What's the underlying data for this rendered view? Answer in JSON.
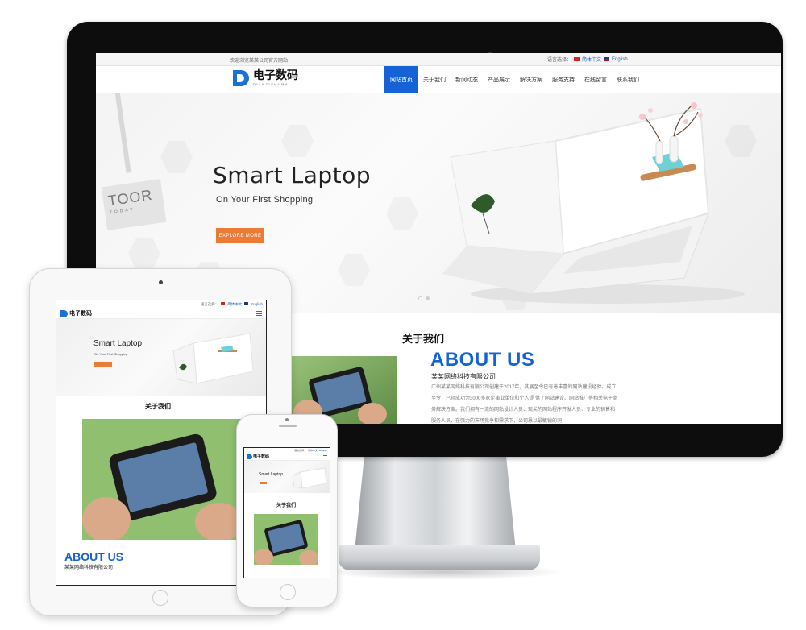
{
  "desktop": {
    "topbar": {
      "welcome": "欢迎浏览某某公司官方网站",
      "lang_label": "语言选择：",
      "lang_cn": "简体中文",
      "lang_en": "English"
    },
    "logo": {
      "cn": "电子数码",
      "en": "DIANZISHUMA"
    },
    "nav": [
      {
        "label": "网站首页",
        "active": true
      },
      {
        "label": "关于我们"
      },
      {
        "label": "新闻动态"
      },
      {
        "label": "产品展示"
      },
      {
        "label": "解决方案"
      },
      {
        "label": "服务支持"
      },
      {
        "label": "在线留言"
      },
      {
        "label": "联系我们"
      }
    ],
    "hero": {
      "title": "Smart Laptop",
      "subtitle": "On Your First Shopping",
      "button": "EXPLORE MORE",
      "card_text": "TOOR",
      "card_sub": "TODAY",
      "slides": 2,
      "active_slide": 1
    },
    "about": {
      "heading": "关于我们",
      "en_heading": "ABOUT US",
      "company": "某某网络科技有限公司",
      "text": "广州某某网络科技有限公司创建于2017年，其展至今已有着丰富的网站建设经验。成立至今，已经成功为3000多家企事业单位和个人提 供了网站建设、网站推广等相关电子商务解决方案。我们拥有一流的网站设计人员、现尖的网站程序开发人员、专业的销售和服务人员，在强力的市场竞争和需求下，公司恩以最敏锐的洞"
    }
  },
  "tablet": {
    "lang_label": "语言选择：",
    "lang_cn": "简体中文",
    "lang_en": "English",
    "logo_cn": "电子数码",
    "hero_title": "Smart Laptop",
    "hero_sub": "On Your First Shopping",
    "about_heading": "关于我们",
    "about_en": "ABOUT US",
    "about_company": "某某网络科技有限公司"
  },
  "phone": {
    "lang_label": "语言选择：",
    "lang_cn": "简体中文",
    "lang_en": "English",
    "logo_cn": "电子数码",
    "hero_title": "Smart Laptop",
    "about_heading": "关于我们"
  },
  "colors": {
    "brand_blue": "#1462d6",
    "accent_orange": "#ec7b36",
    "monitor_bezel": "#0d0d0d"
  }
}
